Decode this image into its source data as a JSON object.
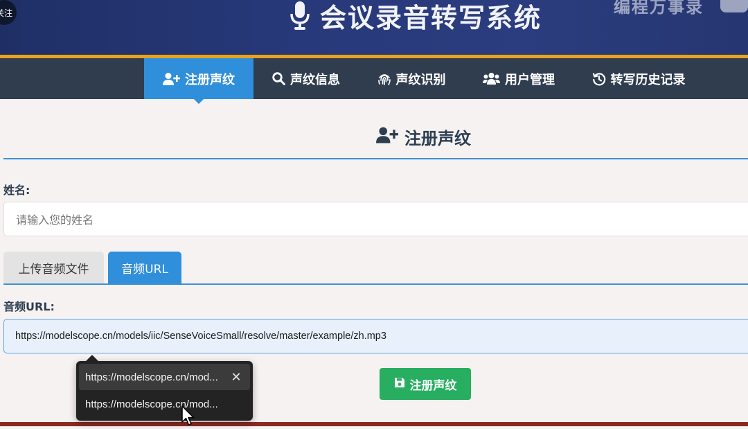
{
  "header": {
    "title": "会议录音转写系统",
    "watermark": "编程万事录",
    "follow_badge": "关注",
    "icon": "microphone-icon"
  },
  "nav": {
    "items": [
      {
        "label": "注册声纹",
        "icon": "user-plus-icon",
        "active": true
      },
      {
        "label": "声纹信息",
        "icon": "search-icon",
        "active": false
      },
      {
        "label": "声纹识别",
        "icon": "fingerprint-icon",
        "active": false
      },
      {
        "label": "用户管理",
        "icon": "users-icon",
        "active": false
      },
      {
        "label": "转写历史记录",
        "icon": "history-icon",
        "active": false
      }
    ]
  },
  "main": {
    "section_title": "注册声纹",
    "section_icon": "user-plus-icon",
    "name_label": "姓名:",
    "name_placeholder": "请输入您的姓名",
    "tabs": [
      {
        "label": "上传音频文件",
        "active": false
      },
      {
        "label": "音频URL",
        "active": true
      }
    ],
    "url_label": "音频URL:",
    "url_value": "https://modelscope.cn/models/iic/SenseVoiceSmall/resolve/master/example/zh.mp3",
    "submit_label": "注册声纹",
    "submit_icon": "save-icon"
  },
  "autocomplete": {
    "items": [
      {
        "text": "https://modelscope.cn/mod...",
        "highlighted": true
      },
      {
        "text": "https://modelscope.cn/mod...",
        "highlighted": false
      }
    ],
    "close_symbol": "✕"
  },
  "colors": {
    "header_bg": "#27397a",
    "accent_stripe": "#e9a21a",
    "nav_bg": "#2f3d4e",
    "active_blue": "#2f8fda",
    "submit_green": "#27ae60"
  }
}
